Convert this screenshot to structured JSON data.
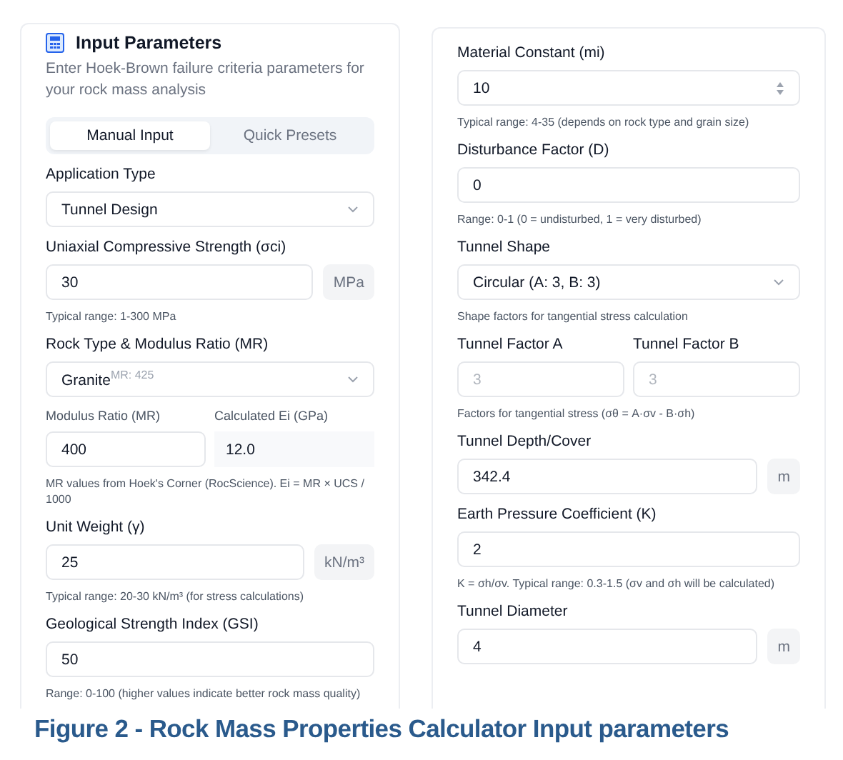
{
  "header": {
    "title": "Input Parameters",
    "description": "Enter Hoek-Brown failure criteria parameters for your rock mass analysis"
  },
  "tabs": [
    {
      "label": "Manual Input",
      "selected": true
    },
    {
      "label": "Quick Presets",
      "selected": false
    }
  ],
  "left_fields": [
    {
      "kind": "select",
      "label": "Application Type",
      "value": "Tunnel Design"
    },
    {
      "kind": "unit",
      "label": "Uniaxial Compressive Strength (σci)",
      "value": "30",
      "unit": "MPa",
      "hint": "Typical range: 1-300 MPa"
    },
    {
      "kind": "select",
      "label": "Rock Type & Modulus Ratio (MR)",
      "value": "Granite",
      "sub": "MR: 425"
    },
    {
      "kind": "sub_pair",
      "items": [
        {
          "kind": "input",
          "label": "Modulus Ratio (MR)",
          "value": "400"
        },
        {
          "kind": "readout",
          "label": "Calculated Ei (GPa)",
          "value": "12.0"
        }
      ],
      "hint": "MR values from Hoek's Corner (RocScience). Ei = MR × UCS / 1000"
    },
    {
      "kind": "unit",
      "label": "Unit Weight (γ)",
      "value": "25",
      "unit": "kN/m³",
      "hint": "Typical range: 20-30 kN/m³ (for stress calculations)"
    },
    {
      "kind": "input",
      "label": "Geological Strength Index (GSI)",
      "value": "50",
      "hint": "Range: 0-100 (higher values indicate better rock mass quality)"
    }
  ],
  "right_fields": [
    {
      "kind": "number",
      "label": "Material Constant (mi)",
      "value": "10",
      "hint": "Typical range: 4-35 (depends on rock type and grain size)"
    },
    {
      "kind": "input",
      "label": "Disturbance Factor (D)",
      "value": "0",
      "hint": "Range: 0-1 (0 = undisturbed, 1 = very disturbed)"
    },
    {
      "kind": "select",
      "label": "Tunnel Shape",
      "value": "Circular (A: 3, B: 3)",
      "hint": "Shape factors for tangential stress calculation"
    },
    {
      "kind": "pair",
      "items": [
        {
          "kind": "input",
          "label": "Tunnel Factor A",
          "value": "3",
          "disabled": true
        },
        {
          "kind": "input",
          "label": "Tunnel Factor B",
          "value": "3",
          "disabled": true
        }
      ],
      "hint": "Factors for tangential stress (σθ = A·σv - B·σh)"
    },
    {
      "kind": "unit",
      "label": "Tunnel Depth/Cover",
      "value": "342.4",
      "unit": "m"
    },
    {
      "kind": "input",
      "label": "Earth Pressure Coefficient (K)",
      "value": "2",
      "hint": "K = σh/σv. Typical range: 0.3-1.5 (σv and σh will be calculated)"
    },
    {
      "kind": "unit",
      "label": "Tunnel Diameter",
      "value": "4",
      "unit": "m"
    }
  ],
  "caption": "Figure 2 - Rock Mass Properties Calculator Input parameters"
}
